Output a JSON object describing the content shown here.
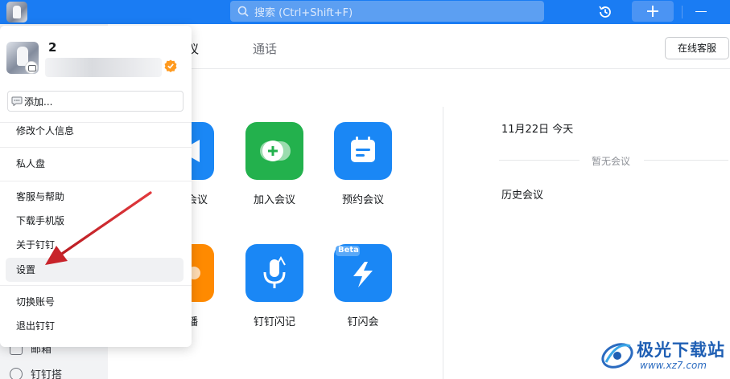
{
  "topbar": {
    "search_placeholder": "搜索 (Ctrl+Shift+F)",
    "icons": [
      "app-avatar",
      "search-icon",
      "history-icon",
      "plus-icon",
      "minimize-icon"
    ]
  },
  "tabs": [
    {
      "label": "议",
      "active": true
    },
    {
      "label": "通话",
      "active": false
    }
  ],
  "service_button": "在线客服",
  "tiles": [
    {
      "label": "会议",
      "color": "#1a87f5",
      "icon": "video-icon"
    },
    {
      "label": "加入会议",
      "color": "#23b14d",
      "icon": "join-icon"
    },
    {
      "label": "预约会议",
      "color": "#1a87f5",
      "icon": "calendar-icon"
    },
    {
      "label": "播",
      "color": "#ff8a00",
      "icon": "live-icon"
    },
    {
      "label": "钉钉闪记",
      "color": "#1a87f5",
      "icon": "mic-icon"
    },
    {
      "label": "钉闪会",
      "color": "#1a87f5",
      "icon": "flash-icon",
      "badge": "Beta"
    }
  ],
  "schedule": {
    "date": "11月22日 今天",
    "empty": "暂无会议",
    "history": "历史会议"
  },
  "sidebar": {
    "items": [
      {
        "label": "邮箱",
        "icon": "mail-icon"
      },
      {
        "label": "钉钉搭",
        "icon": "build-icon"
      }
    ]
  },
  "popover": {
    "name": "2",
    "add_status": "添加...",
    "menu": [
      {
        "label": "修改个人信息",
        "hover": false
      },
      {
        "label": "私人盘",
        "hover": false
      },
      {
        "label": "客服与帮助",
        "hover": false
      },
      {
        "label": "下载手机版",
        "hover": false
      },
      {
        "label": "关于钉钉",
        "hover": false
      },
      {
        "label": "设置",
        "hover": true
      },
      {
        "label": "切换账号",
        "hover": false
      },
      {
        "label": "退出钉钉",
        "hover": false
      }
    ]
  },
  "colors": {
    "brand_blue": "#1a7cf3",
    "arrow_red": "#d9262b",
    "verified_orange": "#ff9a1f"
  },
  "watermark": {
    "title": "极光下载站",
    "url": "www.xz7.com"
  }
}
